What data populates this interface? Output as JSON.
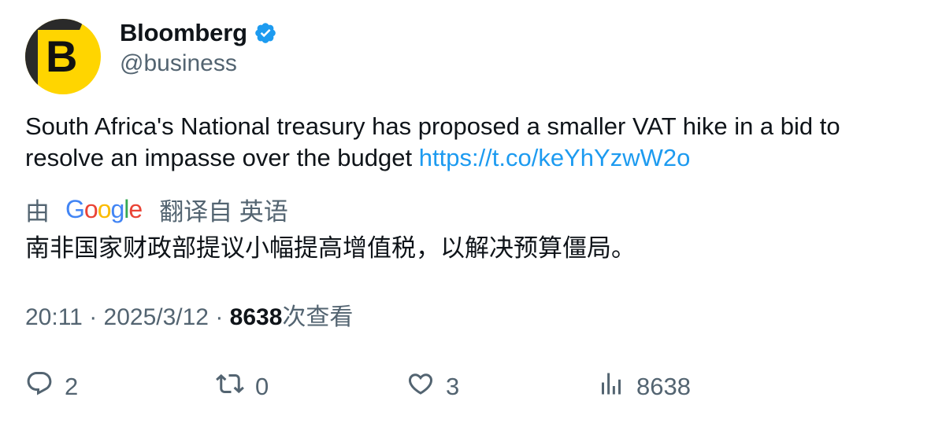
{
  "author": {
    "display_name": "Bloomberg",
    "handle": "@business",
    "avatar_letter": "B",
    "avatar_color": "#ffd500",
    "verified": true,
    "verified_icon": "verified-badge-icon"
  },
  "tweet": {
    "text": "South Africa's National treasury has proposed a smaller VAT hike in a bid to resolve an impasse over the budget ",
    "link": "https://t.co/keYhYzwW2o"
  },
  "translation": {
    "by_label": "由",
    "google_logo": "Google",
    "from_label": "翻译自 英语",
    "text": "南非国家财政部提议小幅提高增值税，以解决预算僵局。"
  },
  "meta": {
    "time": "20:11",
    "separator": "·",
    "date": "2025/3/12",
    "views_count": "8638",
    "views_label": "次查看"
  },
  "actions": {
    "reply_count": "2",
    "retweet_count": "0",
    "like_count": "3",
    "views_count": "8638"
  },
  "colors": {
    "link": "#1d9bf0",
    "secondary_text": "#536471",
    "primary_text": "#0f1419"
  }
}
